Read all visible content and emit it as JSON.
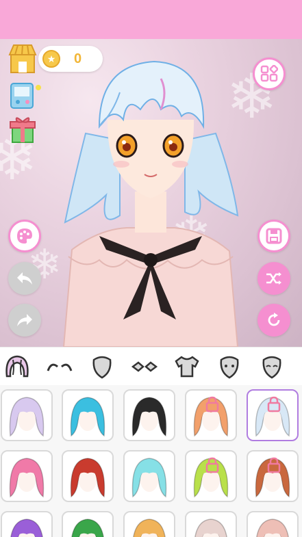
{
  "coins": {
    "value": "0",
    "icon": "star-coin-icon"
  },
  "left_actions": [
    {
      "name": "shop-icon"
    },
    {
      "name": "game-console-icon"
    },
    {
      "name": "gift-icon"
    }
  ],
  "stage_buttons": {
    "menu": "grid-menu-icon",
    "palette": "palette-icon",
    "undo": "undo-icon",
    "redo": "redo-icon",
    "save": "save-icon",
    "shuffle": "shuffle-icon",
    "reset": "refresh-icon"
  },
  "categories": [
    {
      "name": "hair",
      "active": true
    },
    {
      "name": "eyebrows",
      "active": false
    },
    {
      "name": "face",
      "active": false
    },
    {
      "name": "eyes",
      "active": false
    },
    {
      "name": "shirt",
      "active": false
    },
    {
      "name": "mouth",
      "active": false
    },
    {
      "name": "blush",
      "active": false
    }
  ],
  "colors": {
    "accent": "#f58fd0",
    "top_bar": "#f9a8d8",
    "selected_border": "#b07ce0"
  },
  "hair_items": [
    {
      "color": "#d8c9ef",
      "locked": false,
      "selected": false
    },
    {
      "color": "#3bbfe0",
      "locked": false,
      "selected": false
    },
    {
      "color": "#2a2a2a",
      "locked": false,
      "selected": false
    },
    {
      "color": "#f2a06b",
      "locked": true,
      "selected": false
    },
    {
      "color": "#d8e8f6",
      "locked": true,
      "selected": true
    },
    {
      "color": "#f07aa8",
      "locked": false,
      "selected": false
    },
    {
      "color": "#c93b2e",
      "locked": false,
      "selected": false
    },
    {
      "color": "#86e0e6",
      "locked": false,
      "selected": false
    },
    {
      "color": "#b9e04a",
      "locked": true,
      "selected": false
    },
    {
      "color": "#c9683e",
      "locked": true,
      "selected": false
    },
    {
      "color": "#9a5fd8",
      "locked": false,
      "selected": false
    },
    {
      "color": "#3aa64a",
      "locked": false,
      "selected": false
    },
    {
      "color": "#f0b35a",
      "locked": false,
      "selected": false
    },
    {
      "color": "#e8d3cf",
      "locked": false,
      "selected": false
    },
    {
      "color": "#eebfb6",
      "locked": false,
      "selected": false
    }
  ]
}
